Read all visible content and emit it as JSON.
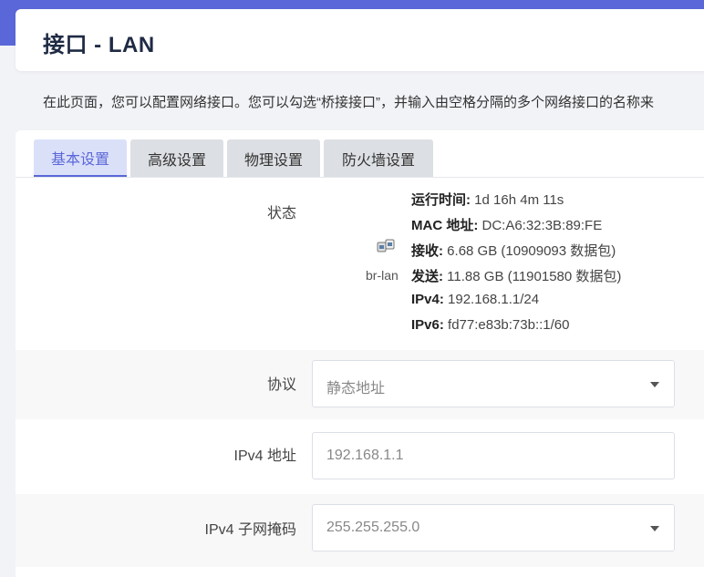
{
  "page": {
    "title": "接口 - LAN",
    "description": "在此页面，您可以配置网络接口。您可以勾选“桥接接口”，并输入由空格分隔的多个网络接口的名称来"
  },
  "tabs": [
    {
      "label": "基本设置",
      "active": true
    },
    {
      "label": "高级设置",
      "active": false
    },
    {
      "label": "物理设置",
      "active": false
    },
    {
      "label": "防火墙设置",
      "active": false
    }
  ],
  "status": {
    "label": "状态",
    "device_icon": "ethernet-port-icon",
    "device": "br-lan",
    "lines": [
      {
        "key": "运行时间",
        "sep": ":",
        "value": " 1d 16h 4m 11s"
      },
      {
        "key": "MAC 地址",
        "sep": ":",
        "value": " DC:A6:32:3B:89:FE"
      },
      {
        "key": "接收",
        "sep": ":",
        "value": " 6.68 GB (10909093 数据包)"
      },
      {
        "key": "发送",
        "sep": ":",
        "value": " 11.88 GB (11901580 数据包)"
      },
      {
        "key": "IPv4",
        "sep": ":",
        "value": " 192.168.1.1/24"
      },
      {
        "key": "IPv6",
        "sep": ":",
        "value": " fd77:e83b:73b::1/60"
      }
    ]
  },
  "form": {
    "protocol": {
      "label": "协议",
      "value": "静态地址"
    },
    "ipv4_address": {
      "label": "IPv4 地址",
      "value": "192.168.1.1"
    },
    "ipv4_netmask": {
      "label": "IPv4 子网掩码",
      "value": "255.255.255.0"
    }
  },
  "colors": {
    "accent": "#5a67d8",
    "background": "#f2f3f7"
  }
}
